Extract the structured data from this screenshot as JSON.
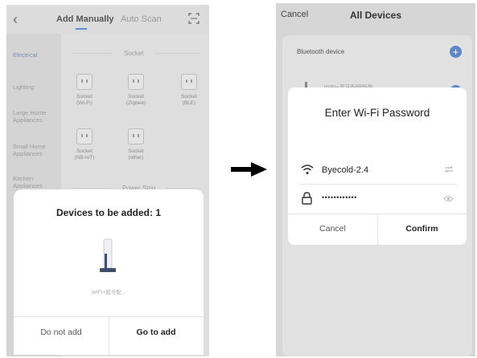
{
  "left_screen": {
    "header": {
      "back_icon": "chevron-left-icon",
      "tab_active": "Add Manually",
      "tab_inactive": "Auto Scan",
      "scan_icon": "scan-frame-icon"
    },
    "sidebar": {
      "items": [
        {
          "label": "Electrical",
          "active": true
        },
        {
          "label": "Lighting"
        },
        {
          "label": "Large Home Appliances"
        },
        {
          "label": "Small Home Appliances"
        },
        {
          "label": "Kitchen Appliances"
        }
      ]
    },
    "sections": {
      "socket_title": "Socket",
      "strip_title": "Power Strip"
    },
    "devices": [
      {
        "line1": "Socket",
        "line2": "(Wi-Fi)"
      },
      {
        "line1": "Socket",
        "line2": "(Zigbee)"
      },
      {
        "line1": "Socket",
        "line2": "(BLE)"
      },
      {
        "line1": "Socket",
        "line2": "(NB-IoT)"
      },
      {
        "line1": "Socket",
        "line2": "(other)"
      }
    ],
    "dialog": {
      "title": "Devices to be added: 1",
      "device_label": "WIFI+蓝牙配...",
      "btn_no": "Do not add",
      "btn_go": "Go to add"
    }
  },
  "right_screen": {
    "cancel": "Cancel",
    "title": "All Devices",
    "bluetooth_label": "Bluetooth device",
    "plus_icon": "plus-circle-icon",
    "background_partial_text": "WIFI+蓝牙配网智能...",
    "wifi_dialog": {
      "title": "Enter Wi-Fi Password",
      "ssid": "Byecold-2.4",
      "password_mask": "••••••••••••",
      "btn_cancel": "Cancel",
      "btn_confirm": "Confirm"
    }
  },
  "colors": {
    "accent_blue": "#5a86cc",
    "sidebar_active": "#6f90c8",
    "overlay_gray": "#dcdcdc"
  }
}
